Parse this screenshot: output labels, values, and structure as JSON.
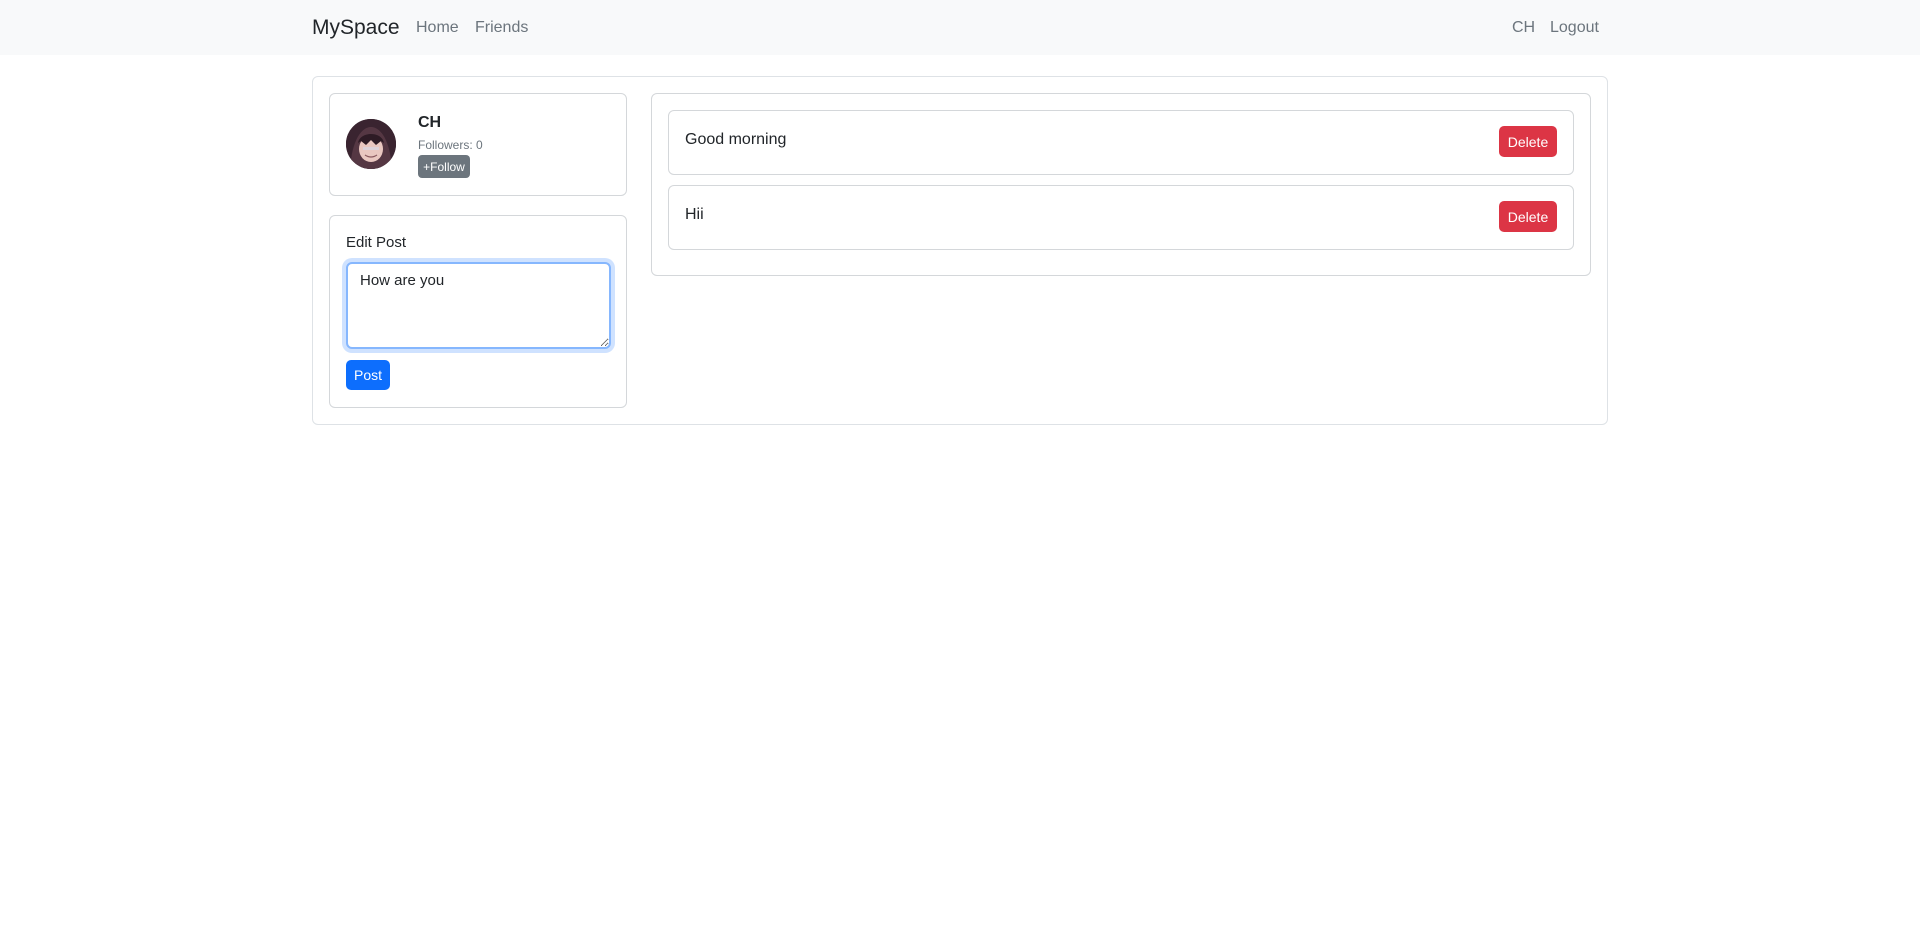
{
  "navbar": {
    "brand": "MySpace",
    "links": [
      "Home",
      "Friends"
    ],
    "user": "CH",
    "logout": "Logout"
  },
  "profile": {
    "name": "CH",
    "followers": "Followers: 0",
    "follow_label": "+Follow",
    "avatar_icon": "user-avatar-icon"
  },
  "editor": {
    "label": "Edit Post",
    "text": "How are you",
    "post_label": "Post"
  },
  "posts": [
    {
      "text": "Good morning",
      "delete_label": "Delete"
    },
    {
      "text": "Hii",
      "delete_label": "Delete"
    }
  ],
  "colors": {
    "primary": "#0d6efd",
    "danger": "#dc3545",
    "secondary": "#6c757d",
    "navbar_bg": "#f8f9fa"
  }
}
